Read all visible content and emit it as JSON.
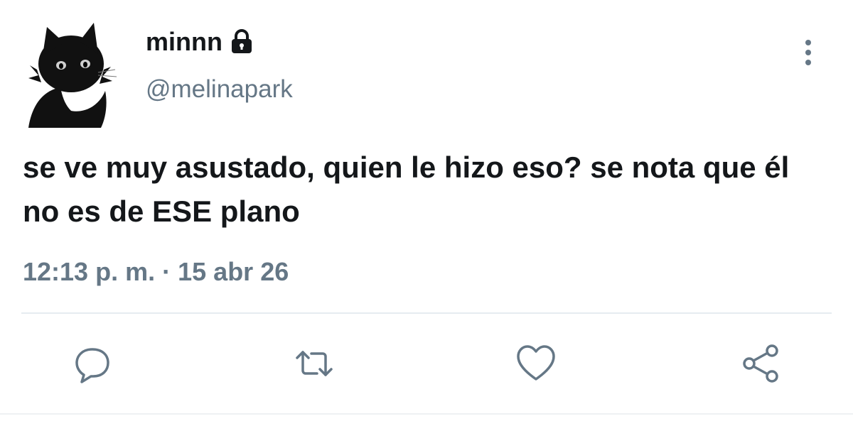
{
  "user": {
    "display_name": "minnn",
    "handle": "@melinapark",
    "protected_icon": "lock-icon",
    "avatar": "black-cat-avatar"
  },
  "tweet": {
    "text": "se ve muy asustado, quien le hizo eso? se nota que él no es de ESE plano",
    "time": "12:13 p. m.",
    "separator": "·",
    "date": "15 abr 26"
  },
  "actions": [
    {
      "icon": "reply-icon"
    },
    {
      "icon": "retweet-icon"
    },
    {
      "icon": "like-icon"
    },
    {
      "icon": "share-icon"
    }
  ],
  "menu": {
    "icon": "more-vertical-icon"
  },
  "colors": {
    "text_primary": "#14171a",
    "text_secondary": "#657786",
    "divider": "#e6ecf0"
  }
}
